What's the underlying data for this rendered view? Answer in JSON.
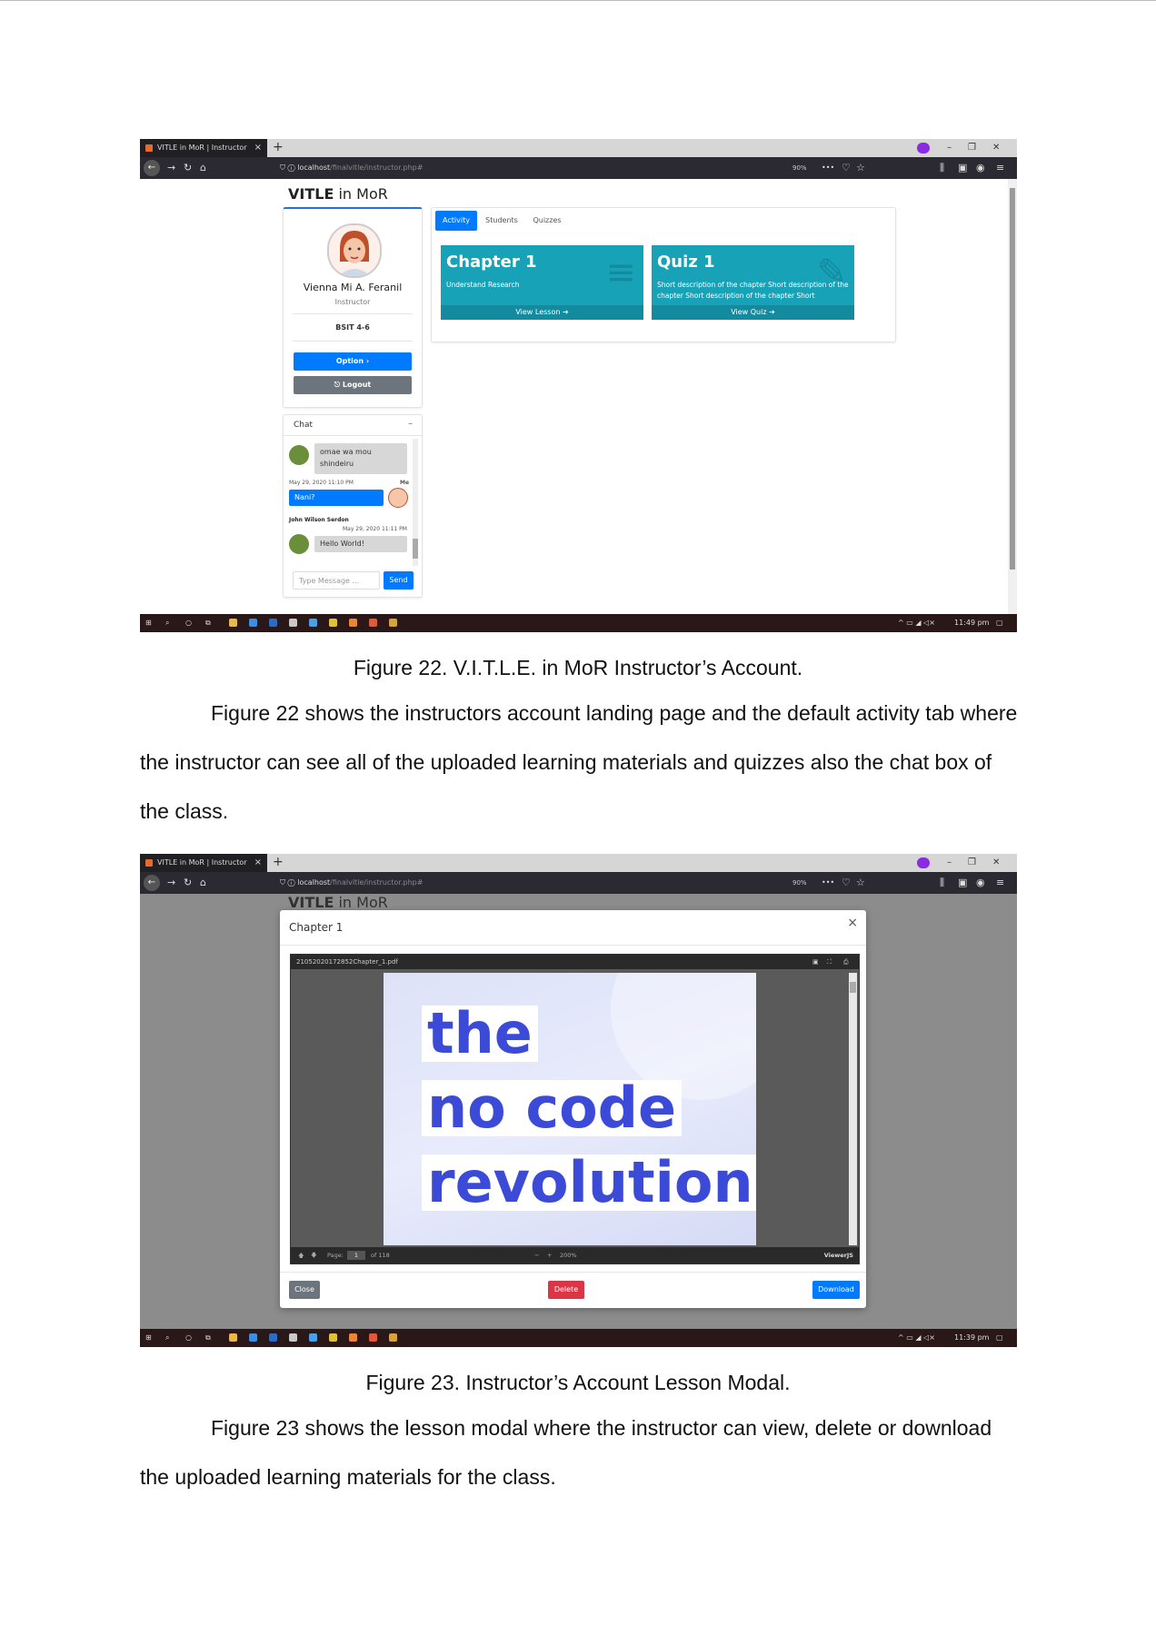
{
  "browser": {
    "tab_title": "VITLE in MoR | Instructor",
    "tab_close": "×",
    "new_tab": "+",
    "url_host": "localhost",
    "url_path": "/finalvitle/instructor.php#",
    "zoom": "90%",
    "more": "•••"
  },
  "taskbar": {
    "time_fig1": "11:49 pm",
    "time_fig2": "11:39 pm"
  },
  "app": {
    "brand_bold": "VITLE",
    "brand_rest": " in MoR",
    "profile": {
      "name": "Vienna Mi A. Feranil",
      "role": "Instructor",
      "section": "BSIT 4-6",
      "option_label": "Option ›",
      "logout_label": "⎋ Logout"
    },
    "tabs": [
      "Activity",
      "Students",
      "Quizzes"
    ],
    "tiles": [
      {
        "title": "Chapter 1",
        "desc": "Understand Research",
        "link": "View Lesson ➔"
      },
      {
        "title": "Quiz 1",
        "desc": "Short description of the chapter Short description of the chapter Short description of the chapter Short",
        "link": "View Quiz ➔"
      }
    ],
    "chat": {
      "title": "Chat",
      "minimize": "–",
      "messages": [
        {
          "text": "omae wa mou shindeiru"
        },
        {
          "time": "May 29, 2020 11:10 PM",
          "who": "Me",
          "text": "Nani?"
        },
        {
          "name": "John Wilson Serdon",
          "time": "May 29, 2020 11:11 PM",
          "text": "Hello World!"
        }
      ],
      "input_placeholder": "Type Message ...",
      "send_label": "Send"
    }
  },
  "modal": {
    "title": "Chapter 1",
    "close_x": "×",
    "file_name": "21052020172852Chapter_1.pdf",
    "page_label": "Page:",
    "page_value": "1",
    "page_total": "of 118",
    "zoom_value": "200%",
    "viewer_brand": "ViewerJS",
    "pdf_lines": [
      "the",
      "no code",
      "revolution"
    ],
    "close_label": "Close",
    "delete_label": "Delete",
    "download_label": "Download"
  },
  "document": {
    "caption1": "Figure 22. V.I.T.L.E. in MoR Instructor’s Account.",
    "para1_l1": "Figure 22 shows the instructors account landing page and the default activity tab where",
    "para1_l2": "the instructor can see all of the uploaded learning materials and quizzes also the chat box of",
    "para1_l3": "the class.",
    "caption2": "Figure 23. Instructor’s Account Lesson Modal.",
    "para2_l1": "Figure 23 shows the lesson modal where the instructor can view, delete or download",
    "para2_l2": "the uploaded learning materials for the class."
  },
  "colors": {
    "primary": "#007bff",
    "info": "#17a2b8",
    "danger": "#dc3545",
    "secondary": "#6c757d"
  }
}
